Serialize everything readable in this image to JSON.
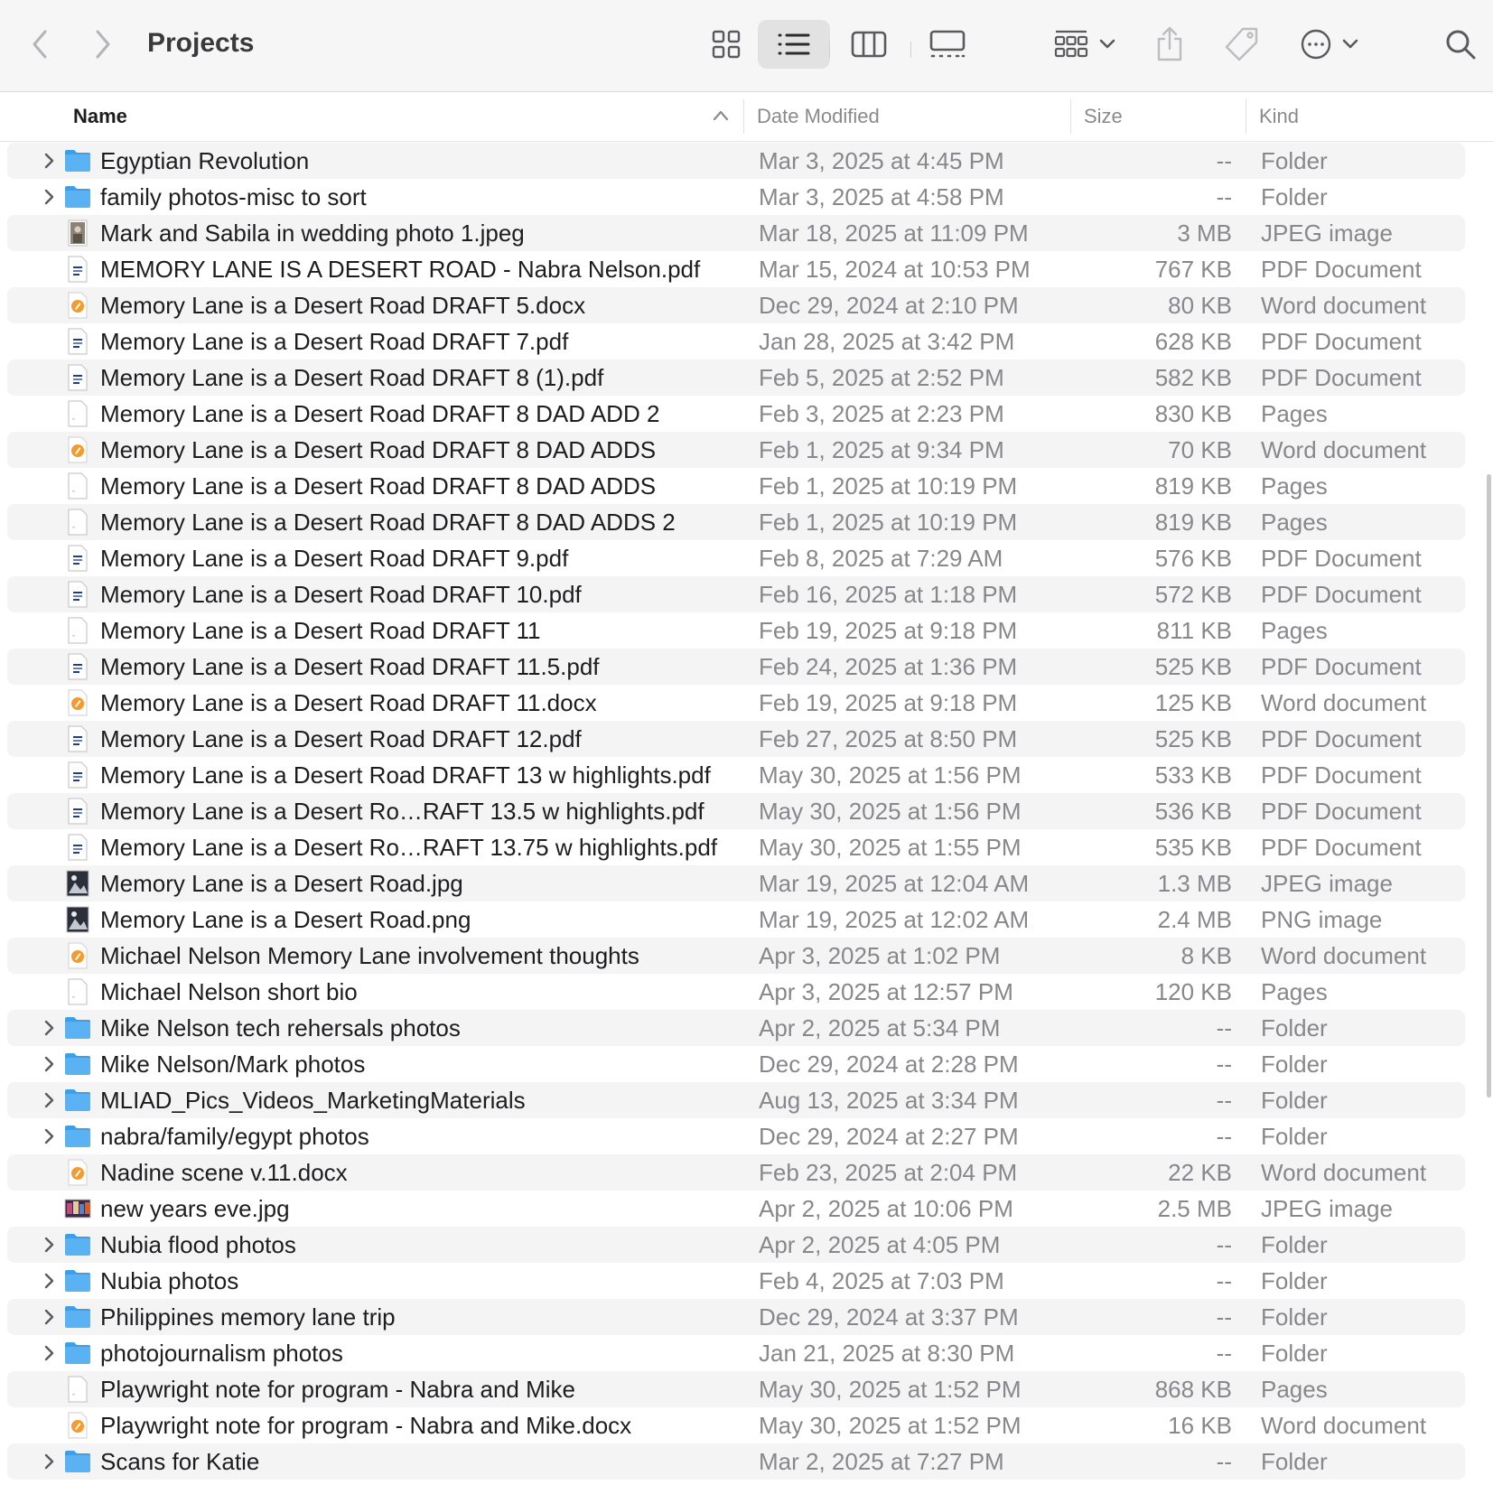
{
  "window": {
    "title": "Projects"
  },
  "toolbar": {
    "icons": [
      "chevron-left-icon",
      "chevron-right-icon",
      "grid-view-icon",
      "list-view-icon",
      "column-view-icon",
      "gallery-view-icon",
      "group-icon",
      "share-icon",
      "tag-icon",
      "more-icon",
      "search-icon"
    ]
  },
  "columns": {
    "name": "Name",
    "date": "Date Modified",
    "size": "Size",
    "kind": "Kind"
  },
  "colors": {
    "folder": "#5ab2f2",
    "word": "#f59a2c",
    "alt_row": "#f4f4f5",
    "secondary_text": "#88888c"
  },
  "files": [
    {
      "name": "Egyptian Revolution",
      "date": "Mar 3, 2025 at 4:45 PM",
      "size": "--",
      "kind": "Folder",
      "type": "folder"
    },
    {
      "name": "family photos-misc to sort",
      "date": "Mar 3, 2025 at 4:58 PM",
      "size": "--",
      "kind": "Folder",
      "type": "folder"
    },
    {
      "name": "Mark and Sabila in wedding photo 1.jpeg",
      "date": "Mar 18, 2025 at 11:09 PM",
      "size": "3 MB",
      "kind": "JPEG image",
      "type": "photo"
    },
    {
      "name": "MEMORY LANE IS A DESERT ROAD - Nabra Nelson.pdf",
      "date": "Mar 15, 2024 at 10:53 PM",
      "size": "767 KB",
      "kind": "PDF Document",
      "type": "pdf"
    },
    {
      "name": "Memory Lane is a Desert Road DRAFT 5.docx",
      "date": "Dec 29, 2024 at 2:10 PM",
      "size": "80 KB",
      "kind": "Word document",
      "type": "word"
    },
    {
      "name": "Memory Lane is a Desert Road DRAFT 7.pdf",
      "date": "Jan 28, 2025 at 3:42 PM",
      "size": "628 KB",
      "kind": "PDF Document",
      "type": "pdf"
    },
    {
      "name": "Memory Lane is a Desert Road DRAFT 8 (1).pdf",
      "date": "Feb 5, 2025 at 2:52 PM",
      "size": "582 KB",
      "kind": "PDF Document",
      "type": "pdf"
    },
    {
      "name": "Memory Lane is a Desert Road DRAFT 8 DAD ADD 2",
      "date": "Feb 3, 2025 at 2:23 PM",
      "size": "830 KB",
      "kind": "Pages",
      "type": "pages"
    },
    {
      "name": "Memory Lane is a Desert Road DRAFT 8 DAD ADDS",
      "date": "Feb 1, 2025 at 9:34 PM",
      "size": "70 KB",
      "kind": "Word document",
      "type": "word"
    },
    {
      "name": "Memory Lane is a Desert Road DRAFT 8 DAD ADDS",
      "date": "Feb 1, 2025 at 10:19 PM",
      "size": "819 KB",
      "kind": "Pages",
      "type": "pages"
    },
    {
      "name": "Memory Lane is a Desert Road DRAFT 8 DAD ADDS 2",
      "date": "Feb 1, 2025 at 10:19 PM",
      "size": "819 KB",
      "kind": "Pages",
      "type": "pages"
    },
    {
      "name": "Memory Lane is a Desert Road DRAFT 9.pdf",
      "date": "Feb 8, 2025 at 7:29 AM",
      "size": "576 KB",
      "kind": "PDF Document",
      "type": "pdf"
    },
    {
      "name": "Memory Lane is a Desert Road DRAFT 10.pdf",
      "date": "Feb 16, 2025 at 1:18 PM",
      "size": "572 KB",
      "kind": "PDF Document",
      "type": "pdf"
    },
    {
      "name": "Memory Lane is a Desert Road DRAFT 11",
      "date": "Feb 19, 2025 at 9:18 PM",
      "size": "811 KB",
      "kind": "Pages",
      "type": "pages"
    },
    {
      "name": "Memory Lane is a Desert Road DRAFT 11.5.pdf",
      "date": "Feb 24, 2025 at 1:36 PM",
      "size": "525 KB",
      "kind": "PDF Document",
      "type": "pdf"
    },
    {
      "name": "Memory Lane is a Desert Road DRAFT 11.docx",
      "date": "Feb 19, 2025 at 9:18 PM",
      "size": "125 KB",
      "kind": "Word document",
      "type": "word"
    },
    {
      "name": "Memory Lane is a Desert Road DRAFT 12.pdf",
      "date": "Feb 27, 2025 at 8:50 PM",
      "size": "525 KB",
      "kind": "PDF Document",
      "type": "pdf"
    },
    {
      "name": "Memory Lane is a Desert Road DRAFT 13 w highlights.pdf",
      "date": "May 30, 2025 at 1:56 PM",
      "size": "533 KB",
      "kind": "PDF Document",
      "type": "pdf"
    },
    {
      "name": "Memory Lane is a Desert Ro…RAFT 13.5 w highlights.pdf",
      "date": "May 30, 2025 at 1:56 PM",
      "size": "536 KB",
      "kind": "PDF Document",
      "type": "pdf"
    },
    {
      "name": "Memory Lane is a Desert Ro…RAFT 13.75 w highlights.pdf",
      "date": "May 30, 2025 at 1:55 PM",
      "size": "535 KB",
      "kind": "PDF Document",
      "type": "pdf"
    },
    {
      "name": "Memory Lane is a Desert Road.jpg",
      "date": "Mar 19, 2025 at 12:04 AM",
      "size": "1.3 MB",
      "kind": "JPEG image",
      "type": "image"
    },
    {
      "name": "Memory Lane is a Desert Road.png",
      "date": "Mar 19, 2025 at 12:02 AM",
      "size": "2.4 MB",
      "kind": "PNG image",
      "type": "image"
    },
    {
      "name": "Michael Nelson Memory Lane involvement thoughts",
      "date": "Apr 3, 2025 at 1:02 PM",
      "size": "8 KB",
      "kind": "Word document",
      "type": "word"
    },
    {
      "name": "Michael Nelson short bio",
      "date": "Apr 3, 2025 at 12:57 PM",
      "size": "120 KB",
      "kind": "Pages",
      "type": "pages"
    },
    {
      "name": "Mike Nelson tech rehersals photos",
      "date": "Apr 2, 2025 at 5:34 PM",
      "size": "--",
      "kind": "Folder",
      "type": "folder"
    },
    {
      "name": "Mike Nelson/Mark photos",
      "date": "Dec 29, 2024 at 2:28 PM",
      "size": "--",
      "kind": "Folder",
      "type": "folder"
    },
    {
      "name": "MLIAD_Pics_Videos_MarketingMaterials",
      "date": "Aug 13, 2025 at 3:34 PM",
      "size": "--",
      "kind": "Folder",
      "type": "folder"
    },
    {
      "name": "nabra/family/egypt photos",
      "date": "Dec 29, 2024 at 2:27 PM",
      "size": "--",
      "kind": "Folder",
      "type": "folder"
    },
    {
      "name": "Nadine scene v.11.docx",
      "date": "Feb 23, 2025 at 2:04 PM",
      "size": "22 KB",
      "kind": "Word document",
      "type": "word"
    },
    {
      "name": "new years eve.jpg",
      "date": "Apr 2, 2025 at 10:06 PM",
      "size": "2.5 MB",
      "kind": "JPEG image",
      "type": "colorphoto"
    },
    {
      "name": "Nubia flood photos",
      "date": "Apr 2, 2025 at 4:05 PM",
      "size": "--",
      "kind": "Folder",
      "type": "folder"
    },
    {
      "name": "Nubia photos",
      "date": "Feb 4, 2025 at 7:03 PM",
      "size": "--",
      "kind": "Folder",
      "type": "folder"
    },
    {
      "name": "Philippines memory lane trip",
      "date": "Dec 29, 2024 at 3:37 PM",
      "size": "--",
      "kind": "Folder",
      "type": "folder"
    },
    {
      "name": "photojournalism photos",
      "date": "Jan 21, 2025 at 8:30 PM",
      "size": "--",
      "kind": "Folder",
      "type": "folder"
    },
    {
      "name": "Playwright note for program - Nabra and Mike",
      "date": "May 30, 2025 at 1:52 PM",
      "size": "868 KB",
      "kind": "Pages",
      "type": "pages"
    },
    {
      "name": "Playwright note for program - Nabra and Mike.docx",
      "date": "May 30, 2025 at 1:52 PM",
      "size": "16 KB",
      "kind": "Word document",
      "type": "word"
    },
    {
      "name": "Scans for Katie",
      "date": "Mar 2, 2025 at 7:27 PM",
      "size": "--",
      "kind": "Folder",
      "type": "folder"
    }
  ]
}
